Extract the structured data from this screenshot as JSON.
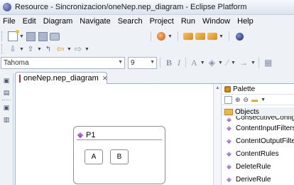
{
  "window": {
    "title": "Resource - Sincronizacion/oneNep.nep_diagram - Eclipse Platform"
  },
  "menu": [
    {
      "label": "File"
    },
    {
      "label": "Edit"
    },
    {
      "label": "Diagram"
    },
    {
      "label": "Navigate"
    },
    {
      "label": "Search"
    },
    {
      "label": "Project"
    },
    {
      "label": "Run"
    },
    {
      "label": "Window"
    },
    {
      "label": "Help"
    }
  ],
  "toolbar": {
    "font_family": "Tahoma",
    "font_size": "9"
  },
  "editor": {
    "tab_label": "oneNep.nep_diagram",
    "node": {
      "title": "P1",
      "children": [
        "A",
        "B"
      ]
    }
  },
  "palette": {
    "title": "Palette",
    "drawer": "Objects",
    "items": [
      "ConsecutiveConfig",
      "ContentInputFilters",
      "ContentOutputFilte",
      "ContentRules",
      "DeleteRule",
      "DeriveRule"
    ]
  }
}
